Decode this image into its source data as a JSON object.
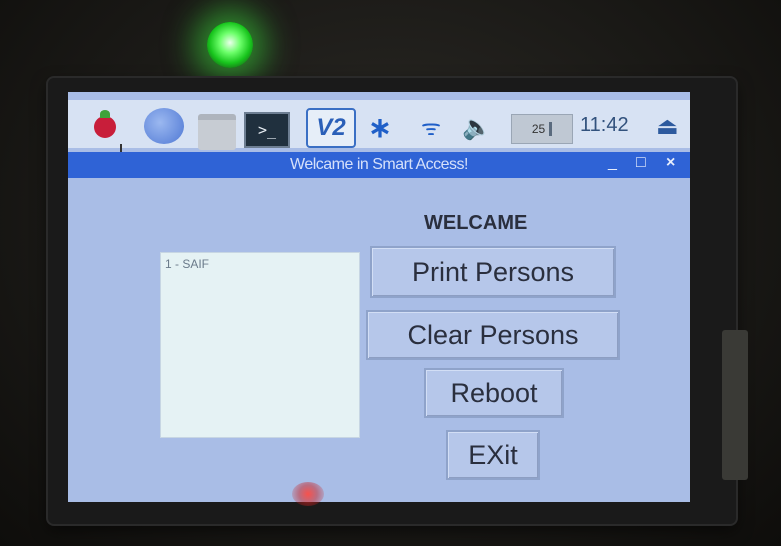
{
  "taskbar": {
    "icons": [
      "raspberry-menu-icon",
      "globe-icon",
      "folder-icon",
      "terminal-icon",
      "vnc-icon",
      "bluetooth-icon",
      "wifi-icon",
      "volume-icon",
      "eject-icon"
    ],
    "terminal_glyph": ">_",
    "vnc_label": "V2",
    "bluetooth_glyph": "∗",
    "wifi_glyph": "ᯤ",
    "volume_glyph": "🔈",
    "cpu_value": "25",
    "clock": "11:42",
    "eject_glyph": "⏏"
  },
  "window": {
    "title": "Welcame in Smart Access!",
    "minimize": "_",
    "maximize": "□",
    "close": "×"
  },
  "main": {
    "welcome": "WELCAME",
    "list_items": [
      "1 - SAIF"
    ],
    "buttons": {
      "print": "Print Persons",
      "clear": "Clear Persons",
      "reboot": "Reboot",
      "exit": "EXit"
    }
  },
  "colors": {
    "window_bg": "#a9bde6",
    "titlebar": "#2f63d6",
    "taskbar": "#d7e2f3",
    "led": "#6cff6a"
  }
}
